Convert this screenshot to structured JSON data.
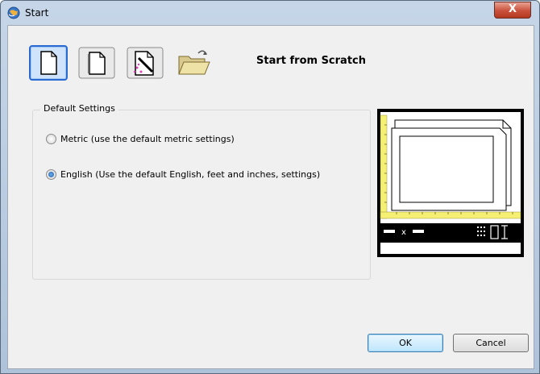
{
  "window": {
    "title": "Start",
    "close_label": "X"
  },
  "mode_buttons": [
    {
      "name": "start-from-scratch",
      "selected": true
    },
    {
      "name": "use-a-template",
      "selected": false
    },
    {
      "name": "use-a-wizard",
      "selected": false
    },
    {
      "name": "open-a-drawing",
      "selected": false
    }
  ],
  "mode_title": "Start from Scratch",
  "default_settings": {
    "label": "Default Settings",
    "options": [
      {
        "label": "Metric (use the default metric settings)",
        "checked": false
      },
      {
        "label": "English (Use the default English, feet and inches, settings)",
        "checked": true
      }
    ]
  },
  "preview": {
    "axis_label": "x"
  },
  "buttons": {
    "ok": "OK",
    "cancel": "Cancel"
  },
  "colors": {
    "title_bar": "#b8cce2",
    "close_button": "#c9503b",
    "ruler": "#f5ef74",
    "selected_border": "#2a6ad1"
  }
}
